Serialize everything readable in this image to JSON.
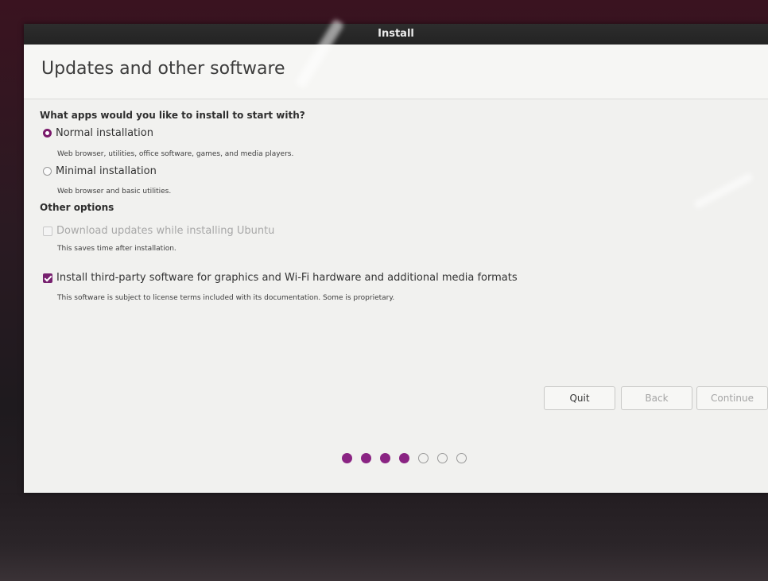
{
  "window": {
    "title": "Install"
  },
  "page": {
    "title": "Updates and other software"
  },
  "apps_section": {
    "heading": "What apps would you like to install to start with?",
    "normal": {
      "label": "Normal installation",
      "description": "Web browser, utilities, office software, games, and media players.",
      "selected": true
    },
    "minimal": {
      "label": "Minimal installation",
      "description": "Web browser and basic utilities.",
      "selected": false
    }
  },
  "other_section": {
    "heading": "Other options",
    "download_updates": {
      "label": "Download updates while installing Ubuntu",
      "description": "This saves time after installation.",
      "checked": false,
      "enabled": false
    },
    "third_party": {
      "label": "Install third-party software for graphics and Wi-Fi hardware and additional media formats",
      "description": "This software is subject to license terms included with its documentation. Some is proprietary.",
      "checked": true,
      "enabled": true
    }
  },
  "buttons": {
    "quit": "Quit",
    "back": "Back",
    "continue": "Continue"
  },
  "progress": {
    "total_steps": 7,
    "completed_steps": 4
  },
  "colors": {
    "accent": "#77216f",
    "titlebar": "#2d2d2d"
  }
}
